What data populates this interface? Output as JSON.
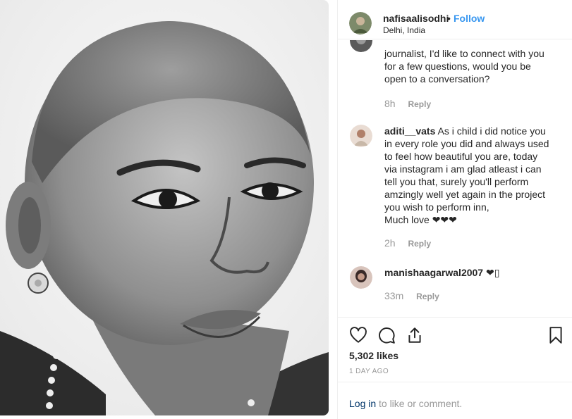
{
  "post": {
    "username": "nafisaalisodhi",
    "dot": "•",
    "follow_label": "Follow",
    "location": "Delhi, India"
  },
  "comments": [
    {
      "username": "",
      "lines": [
        "journalist, I'd like to connect with you",
        "for a few questions, would you be",
        "open to a conversation?"
      ],
      "time": "8h",
      "reply": "Reply"
    },
    {
      "username": "aditi__vats",
      "first_line": "As i child i did notice you",
      "lines": [
        "in every role you did and always used",
        "to feel how beautiful you are, today",
        "via instagram i am glad atleast i can",
        "tell you that, surely you'll perform",
        "amzingly well yet again in the project",
        "you wish to perform inn,",
        "Much love ❤❤❤"
      ],
      "time": "2h",
      "reply": "Reply"
    },
    {
      "username": "manishaagarwal2007",
      "first_line": "❤▯",
      "time": "33m",
      "reply": "Reply"
    }
  ],
  "actions": {
    "like_icon": "heart-icon",
    "comment_icon": "comment-icon",
    "share_icon": "share-icon",
    "save_icon": "bookmark-icon",
    "likes": "5,302 likes",
    "date": "1 DAY AGO"
  },
  "footer": {
    "login_link": "Log in",
    "login_rest": "to like or comment."
  },
  "colors": {
    "link_blue": "#3897f0",
    "text": "#262626",
    "muted": "#999999",
    "border": "#efefef",
    "login_link": "#003569"
  }
}
